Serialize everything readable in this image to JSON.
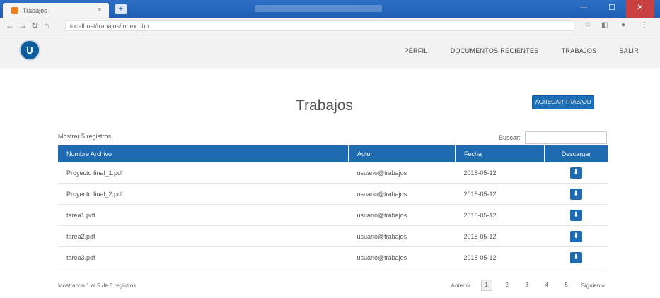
{
  "browser": {
    "tab_title": "Trabajos",
    "tab_close": "×",
    "new_tab": "+",
    "url": "localhost/trabajos/index.php",
    "window_controls": [
      "—",
      "☐",
      "✕"
    ]
  },
  "app": {
    "logo_text": "U",
    "menu": [
      "PERFIL",
      "DOCUMENTOS RECIENTES",
      "TRABAJOS",
      "SALIR"
    ]
  },
  "main": {
    "title": "Trabajos",
    "add_button": "AGREGAR TRABAJO",
    "show_entries": "Mostrar 5 registros",
    "search_label": "Buscar:",
    "search_value": ""
  },
  "table": {
    "headers": [
      "Nombre Archivo",
      "Autor",
      "Fecha",
      "Descargar"
    ],
    "rows": [
      {
        "file": "Proyecto final_1.pdf",
        "author": "usuario@trabajos",
        "date": "2018-05-12"
      },
      {
        "file": "Proyecto final_2.pdf",
        "author": "usuario@trabajos",
        "date": "2018-05-12"
      },
      {
        "file": "tarea1.pdf",
        "author": "usuario@trabajos",
        "date": "2018-05-12"
      },
      {
        "file": "tarea2.pdf",
        "author": "usuario@trabajos",
        "date": "2018-05-12"
      },
      {
        "file": "tarea3.pdf",
        "author": "usuario@trabajos",
        "date": "2018-05-12"
      }
    ],
    "download_icon": "⬇"
  },
  "footer": {
    "info": "Mostrando 1 al 5 de 5 registros",
    "previous": "Anterior",
    "pages": [
      "1",
      "2",
      "3",
      "4",
      "5"
    ],
    "next": "Siguiente"
  }
}
